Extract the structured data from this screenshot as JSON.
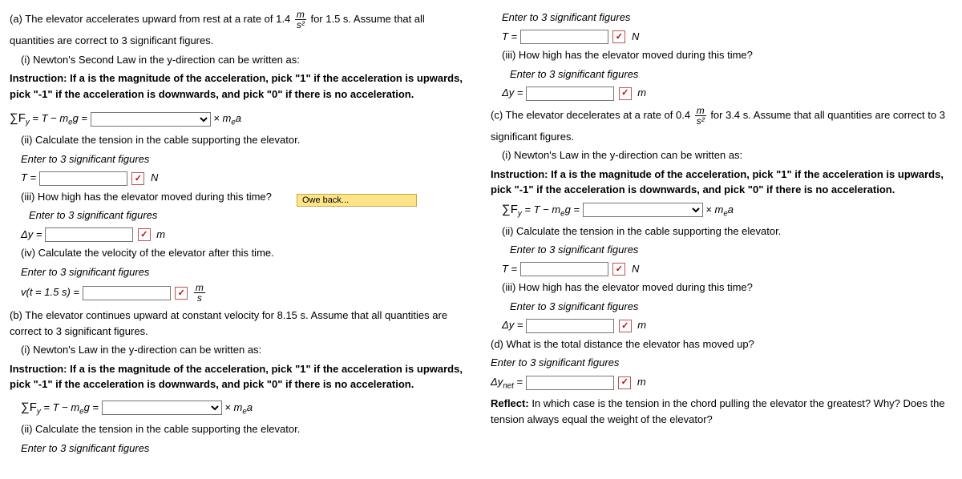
{
  "tooltip": "Owe back...",
  "left": {
    "a_intro_1": "(a)  The elevator accelerates upward from rest at a rate of 1.4 ",
    "a_intro_2": " for 1.5 s. Assume that all",
    "a_intro_3": "quantities are correct to 3 significant figures.",
    "a_i": "(i) Newton's Second Law in the y-direction can be written as:",
    "instruction": "Instruction:  If a is the magnitude of the acceleration, pick \"1\" if the acceleration is upwards, pick \"-1\" if the acceleration is downwards, and pick \"0\" if there is no acceleration.",
    "eq_prefix": "∑F",
    "eq_mid": " = T − m",
    "eq_g": "g = ",
    "eq_tail": " × m",
    "eq_a": "a",
    "a_ii": "(ii) Calculate the tension in the cable supporting the elevator.",
    "sig": "Enter to 3 significant figures",
    "T_eq": "T = ",
    "unit_N": "N",
    "a_iii": "(iii) How high has the elevator moved during this time?",
    "dy_eq": "Δy = ",
    "unit_m": "m",
    "a_iv": "(iv) Calculate the velocity of the elevator after this time.",
    "v_eq": "v(t = 1.5 s) = ",
    "b_intro": "(b) The elevator continues upward at constant velocity for 8.15 s. Assume that all quantities are correct to 3 significant figures.",
    "b_i": "(i) Newton's Law in the y-direction can be written as:",
    "b_ii": "(ii) Calculate the tension in the cable supporting the elevator."
  },
  "right": {
    "sig": "Enter to 3 significant figures",
    "T_eq": "T = ",
    "unit_N": "N",
    "b_iii": "(iii) How high has the elevator moved during this time?",
    "dy_eq": "Δy = ",
    "unit_m": "m",
    "c_intro_1": "(c) The elevator decelerates at a rate of 0.4 ",
    "c_intro_2": " for 3.4 s. Assume that all quantities are correct to 3",
    "c_intro_3": "significant figures.",
    "c_i": "(i) Newton's Law in the y-direction can be written as:",
    "instruction": "Instruction: If a is the magnitude of the acceleration, pick \"1\" if the acceleration is upwards, pick \"-1\" if the acceleration is downwards, and pick \"0\" if there is no acceleration.",
    "c_ii": "(ii) Calculate the tension in the cable supporting the elevator.",
    "c_iii": "(iii) How high has the elevator moved during this time?",
    "d": "(d) What is the total distance the elevator has moved up?",
    "dynet_eq": "Δy",
    "dynet_sub": "net",
    "dynet_eq2": " = ",
    "reflect": "Reflect: In which case is the tension in the chord pulling the elevator the greatest? Why? Does the tension always equal the weight of the elevator?"
  },
  "frac": {
    "m": "m",
    "s2": "s²",
    "s": "s"
  },
  "y_sub": "y",
  "e_sub": "e"
}
